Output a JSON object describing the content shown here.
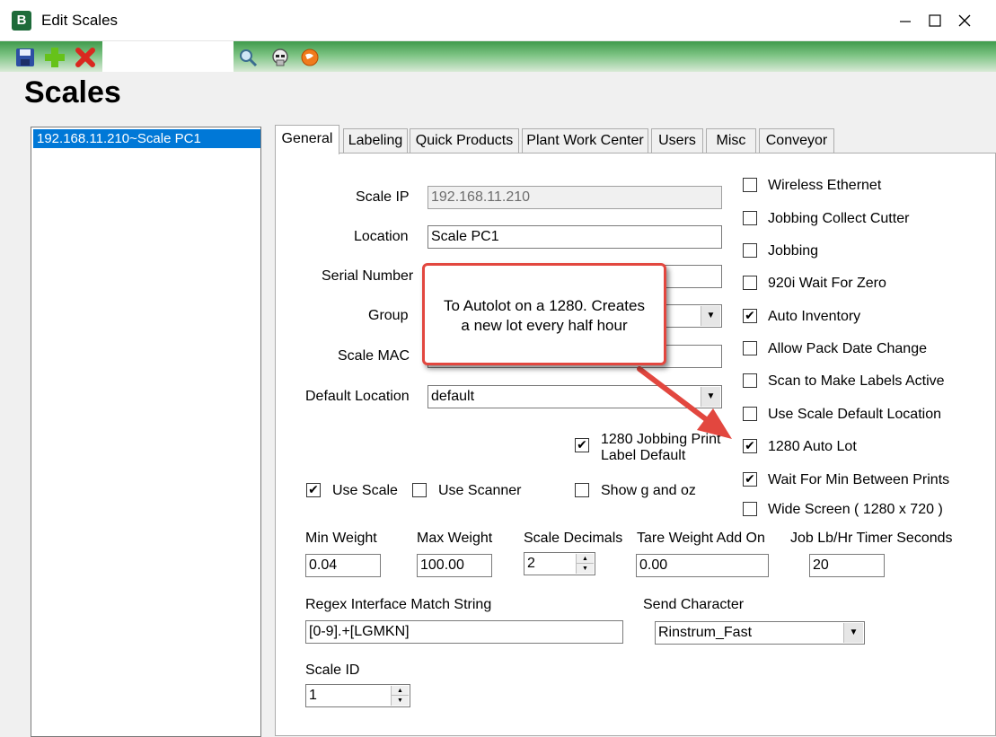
{
  "window": {
    "title": "Edit Scales",
    "app_icon_text": "B"
  },
  "toolbar": {
    "search_value": ""
  },
  "page": {
    "title": "Scales"
  },
  "scale_list": {
    "items": [
      {
        "label": "192.168.11.210~Scale PC1",
        "selected": true
      }
    ]
  },
  "tabs": [
    {
      "label": "General",
      "active": true
    },
    {
      "label": "Labeling"
    },
    {
      "label": "Quick Products"
    },
    {
      "label": "Plant Work Center"
    },
    {
      "label": "Users"
    },
    {
      "label": "Misc"
    },
    {
      "label": "Conveyor"
    }
  ],
  "general": {
    "scale_ip": {
      "label": "Scale IP",
      "value": "192.168.11.210"
    },
    "location": {
      "label": "Location",
      "value": "Scale PC1"
    },
    "serial_number": {
      "label": "Serial Number",
      "value": ""
    },
    "group": {
      "label": "Group",
      "value": ""
    },
    "scale_mac": {
      "label": "Scale MAC",
      "value": ""
    },
    "default_location": {
      "label": "Default Location",
      "value": "default"
    },
    "jobbing_print_label_default": {
      "label_line1": "1280 Jobbing Print",
      "label_line2": "Label Default",
      "checked": true
    },
    "use_scale": {
      "label": "Use Scale",
      "checked": true
    },
    "use_scanner": {
      "label": "Use Scanner",
      "checked": false
    },
    "show_g_oz": {
      "label": "Show g and oz",
      "checked": false
    },
    "min_weight": {
      "label": "Min Weight",
      "value": "0.04"
    },
    "max_weight": {
      "label": "Max Weight",
      "value": "100.00"
    },
    "scale_decimals": {
      "label": "Scale Decimals",
      "value": "2"
    },
    "tare_weight": {
      "label": "Tare Weight Add On",
      "value": "0.00"
    },
    "job_timer": {
      "label": "Job Lb/Hr Timer Seconds",
      "value": "20"
    },
    "regex": {
      "label": "Regex Interface Match String",
      "value": "[0-9].+[LGMKN]"
    },
    "send_character": {
      "label": "Send Character",
      "value": "Rinstrum_Fast"
    },
    "scale_id": {
      "label": "Scale ID",
      "value": "1"
    },
    "options": [
      {
        "label": "Wireless Ethernet",
        "checked": false
      },
      {
        "label": "Jobbing Collect Cutter",
        "checked": false
      },
      {
        "label": "Jobbing",
        "checked": false
      },
      {
        "label": "920i Wait For Zero",
        "checked": false
      },
      {
        "label": "Auto Inventory",
        "checked": true
      },
      {
        "label": "Allow Pack Date Change",
        "checked": false
      },
      {
        "label": "Scan to Make Labels Active",
        "checked": false
      },
      {
        "label": "Use Scale Default Location",
        "checked": false
      },
      {
        "label": "1280 Auto Lot",
        "checked": true
      },
      {
        "label": "Wait For Min Between Prints",
        "checked": true
      },
      {
        "label": "Wide Screen ( 1280 x 720 )",
        "checked": false
      }
    ]
  },
  "callout": {
    "line1": "To Autolot on a 1280.  Creates",
    "line2": "a new lot every half hour"
  },
  "glyphs": {
    "check": "✔",
    "dropdown": "▼",
    "spin_up": "▲",
    "spin_down": "▼"
  },
  "colors": {
    "callout_border": "#e2473f",
    "arrow": "#e2473f",
    "selection": "#0078d7",
    "toolbar_green": "#3f9a4b"
  }
}
